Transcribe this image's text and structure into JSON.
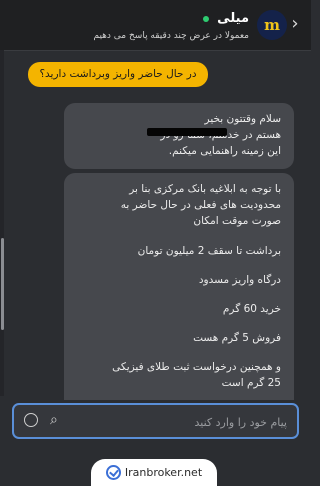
{
  "header": {
    "back_icon": "chevron-right-icon",
    "avatar_letter": "m",
    "name": "میلی",
    "online_color": "#2ecc71",
    "status": "معمولا در عرض چند دقیقه پاسخ می دهیم"
  },
  "messages": {
    "user": "در حال حاضر واریز وبرداشت دارید؟",
    "bot1": {
      "lines": [
        "سلام وقتتون بخیر",
        "هستم در خدمتم، شما رو در",
        "این زمینه راهنمایی میکنم."
      ]
    },
    "bot2": {
      "lines": [
        "با توجه به ابلاغیه بانک مرکزی بنا بر",
        "محدودیت های فعلی در حال حاضر به",
        "صورت موقت امکان",
        "برداشت تا سقف 2 میلیون تومان",
        "درگاه واریز مسدود",
        "خرید 60 گرم",
        "فروش 5 گرم هست",
        "و همچنین درخواست ثبت طلای فیزیکی",
        "25 گرم است"
      ]
    }
  },
  "composer": {
    "placeholder": "پیام خود را وارد کنید",
    "emoji_icon": "smiley-icon",
    "attach_icon": "paperclip-icon",
    "focus_color": "#5a8fd8"
  },
  "brand": {
    "text": "Iranbroker.net",
    "icon": "check-circle-icon"
  },
  "colors": {
    "accent": "#f4b400",
    "bot_bubble": "#46484d",
    "background": "#2b2d31"
  }
}
